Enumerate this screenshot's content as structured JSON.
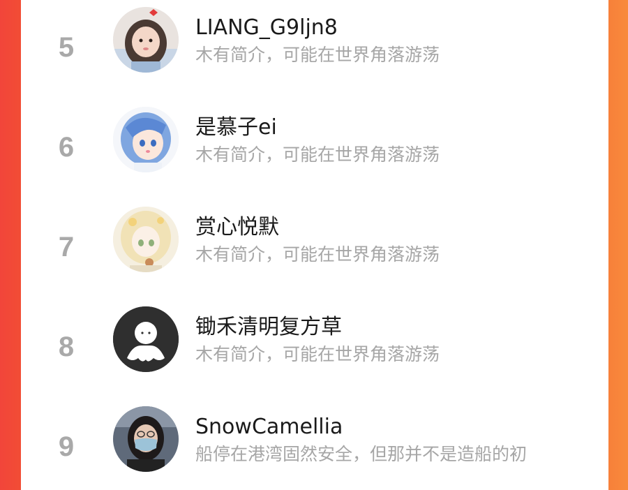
{
  "colors": {
    "left_accent": "#f2453a",
    "right_accent": "#f7803a",
    "rank_color": "#a9a9a9",
    "name_color": "#1a1a1a",
    "bio_color": "#a6a6a6"
  },
  "users": [
    {
      "rank": "5",
      "name": "LIANG_G9ljn8",
      "bio": "木有简介，可能在世界角落游荡",
      "avatar": "girl-with-red-bow-avatar"
    },
    {
      "rank": "6",
      "name": "是慕子ei",
      "bio": "木有简介，可能在世界角落游荡",
      "avatar": "anime-blue-hair-avatar"
    },
    {
      "rank": "7",
      "name": "赏心悦默",
      "bio": "木有简介，可能在世界角落游荡",
      "avatar": "anime-blonde-girl-avatar"
    },
    {
      "rank": "8",
      "name": "锄禾清明复方草",
      "bio": "木有简介，可能在世界角落游荡",
      "avatar": "default-ghost-avatar"
    },
    {
      "rank": "9",
      "name": "SnowCamellia",
      "bio": "船停在港湾固然安全，但那并不是造船的初",
      "avatar": "masked-person-avatar"
    }
  ]
}
